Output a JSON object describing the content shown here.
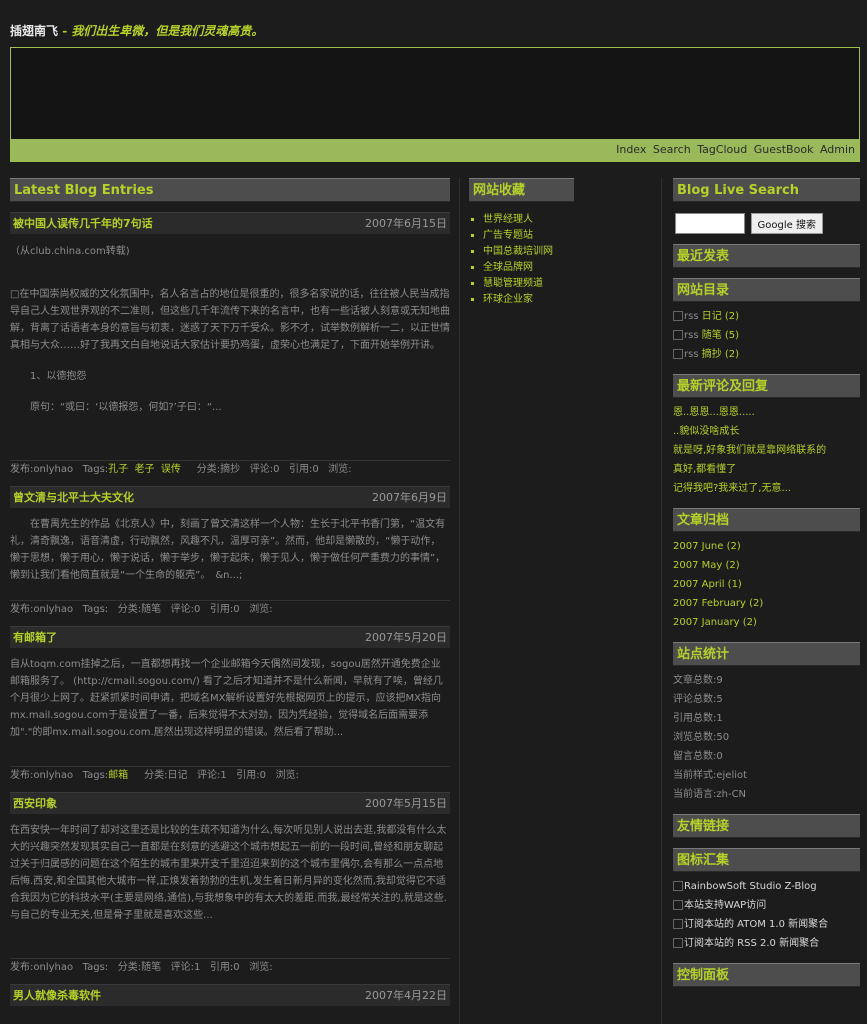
{
  "header": {
    "site_name": "插翅南飞",
    "separator": " - ",
    "slogan": "我们出生卑微，但是我们灵魂高贵。"
  },
  "nav": [
    "Index",
    "Search",
    "TagCloud",
    "GuestBook",
    "Admin"
  ],
  "main": {
    "heading": "Latest Blog Entries",
    "posts": [
      {
        "title": "被中国人误传几千年的7句话",
        "date": "2007年6月15日",
        "paragraphs": [
          "（从club.china.com转载)",
          "",
          "□在中国崇尚权威的文化氛围中，名人名言占的地位是很重的，很多名家说的话，往往被人民当成指导自己人生观世界观的不二准则，但这些几千年流传下来的名言中，也有一些话被人刻意或无知地曲解，背离了话语者本身的意旨与初衷，迷惑了天下万千受众。影不才，试举数例解析一二，以正世情真相与大众……好了我再文白自地说话大家估计要扔鸡蛋，虚荣心也满足了，下面开始举例开讲。",
          "　　1、以德抱怨",
          "　　原句：“或曰：‘以德报怨，何如?’子曰：“..."
        ],
        "footer": {
          "author": "发布:onlyhao",
          "tags_label": "Tags:",
          "tags": [
            "孔子",
            "老子",
            "误传"
          ],
          "category": "分类:摘抄",
          "comments": "评论:0",
          "trackbacks": "引用:0",
          "views": "浏览:"
        }
      },
      {
        "title": "曾文清与北平士大夫文化",
        "date": "2007年6月9日",
        "paragraphs": [
          "　　在曹禺先生的作品《北京人》中，刻画了曾文清这样一个人物：生长于北平书香门第，“温文有礼，清奇飘逸，语音清虚，行动飘然，风趣不凡，温厚可亲”。然而，他却是懒散的，“懒于动作，懒于思想，懒于用心，懒于说话，懒于举步，懒于起床，懒于见人，懒于做任何严重费力的事情”，懒到让我们看他简直就是“一个生命的躯壳”。　&n...;"
        ],
        "footer": {
          "author": "发布:onlyhao",
          "tags_label": "Tags:",
          "tags": [],
          "category": "分类:随笔",
          "comments": "评论:0",
          "trackbacks": "引用:0",
          "views": "浏览:"
        }
      },
      {
        "title": "有邮箱了",
        "date": "2007年5月20日",
        "paragraphs": [
          "自从toqm.com挂掉之后，一直都想再找一个企业邮箱今天偶然间发现，sogou居然开通免费企业邮箱服务了。 (http://cmail.sogou.com/) 看了之后才知道并不是什么新闻，早就有了唉，曾经几个月很少上网了。赶紧抓紧时间申请，把域名MX解析设置好先根据网页上的提示，应该把MX指向mx.mail.sogou.com于是设置了一番，后来觉得不太对劲，因为凭经验，觉得域名后面需要添加\".\"的即mx.mail.sogou.com.居然出现这样明显的错误。然后看了帮助..."
        ],
        "footer": {
          "author": "发布:onlyhao",
          "tags_label": "Tags:",
          "tags": [
            "邮箱"
          ],
          "category": "分类:日记",
          "comments": "评论:1",
          "trackbacks": "引用:0",
          "views": "浏览:"
        }
      },
      {
        "title": "西安印象",
        "date": "2007年5月15日",
        "paragraphs": [
          "在西安快一年时间了却对这里还是比较的生疏不知道为什么,每次听见别人说出去逛,我都没有什么太大的兴趣突然发现其实自己一直都是在刻意的逃避这个城市想起五一前的一段时间,曾经和朋友聊起过关于归属感的问题在这个陌生的城市里来开支千里迢迢来到的这个城市里偶尔,会有那么一点点地后悔.西安,和全国其他大城市一样,正焕发着勃勃的生机,发生着日新月异的变化然而,我却觉得它不适合我因为它的科技水平(主要是网络,通信),与我想象中的有太大的差距.而我,最经常关注的,就是这些. 与自己的专业无关,但是骨子里就是喜欢这些..."
        ],
        "footer": {
          "author": "发布:onlyhao",
          "tags_label": "Tags:",
          "tags": [],
          "category": "分类:随笔",
          "comments": "评论:1",
          "trackbacks": "引用:0",
          "views": "浏览:"
        }
      },
      {
        "title": "男人就像杀毒软件",
        "date": "2007年4月22日",
        "paragraphs": [],
        "footer": null
      }
    ]
  },
  "favorites": {
    "heading": "网站收藏",
    "links": [
      "世界经理人",
      "广告专题站",
      "中国总裁培训网",
      "全球品牌网",
      "慧聪管理频道",
      "环球企业家"
    ]
  },
  "sidebar": {
    "search_heading": "Blog Live Search",
    "search_value": "",
    "search_button": "Google 搜索",
    "recent_heading": "最近发表",
    "catalog_heading": "网站目录",
    "catalog": [
      {
        "icon_alt": "rss",
        "label": "日记 (2)"
      },
      {
        "icon_alt": "rss",
        "label": "随笔 (5)"
      },
      {
        "icon_alt": "rss",
        "label": "摘抄 (2)"
      }
    ],
    "comments_heading": "最新评论及回复",
    "comments": [
      "恩..恩恩...恩恩.....",
      "..貌似没啥成长",
      "就是呀,好象我们就是靠网络联系的",
      "真好,都看懂了",
      "记得我吧?我来过了,无意..."
    ],
    "archive_heading": "文章归档",
    "archive": [
      "2007 June (2)",
      "2007 May (2)",
      "2007 April (1)",
      "2007 February (2)",
      "2007 January (2)"
    ],
    "stats_heading": "站点统计",
    "stats": [
      "文章总数:9",
      "评论总数:5",
      "引用总数:1",
      "浏览总数:50",
      "留言总数:0",
      "当前样式:ejeliot",
      "当前语言:zh-CN"
    ],
    "friends_heading": "友情链接",
    "badges_heading": "图标汇集",
    "badges": [
      "RainbowSoft Studio Z-Blog",
      "本站支持WAP访问",
      "订阅本站的 ATOM 1.0 新闻聚合",
      "订阅本站的 RSS 2.0 新闻聚合"
    ],
    "control_heading": "控制面板"
  },
  "colors": {
    "accent": "#b4d12a",
    "background": "#1c1c1c",
    "bar": "#4d4d4d",
    "nav": "#9ab95a"
  }
}
